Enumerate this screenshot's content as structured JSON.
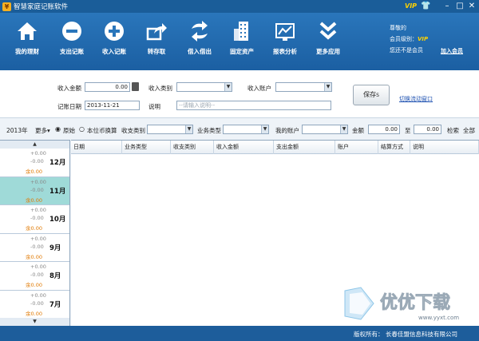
{
  "window": {
    "title": "智慧家庭记账软件",
    "vip": "VIP"
  },
  "toolbar": {
    "items": [
      {
        "label": "我的理财",
        "icon": "home-icon"
      },
      {
        "label": "支出记账",
        "icon": "minus-circle-icon"
      },
      {
        "label": "收入记账",
        "icon": "plus-circle-icon"
      },
      {
        "label": "转存取",
        "icon": "share-arrow-icon"
      },
      {
        "label": "借入借出",
        "icon": "exchange-icon"
      },
      {
        "label": "固定资产",
        "icon": "building-icon"
      },
      {
        "label": "报表分析",
        "icon": "chart-icon"
      },
      {
        "label": "更多应用",
        "icon": "chevron-double-down-icon"
      }
    ]
  },
  "member": {
    "greeting": "尊敬的",
    "level_label": "会员级别：",
    "level_value": "VIP",
    "status": "您还不是会员",
    "join": "加入会员"
  },
  "form": {
    "amount_label": "收入金额",
    "amount_value": "0.00",
    "category_label": "收入类别",
    "account_label": "收入账户",
    "date_label": "记账日期",
    "date_value": "2013-11-21",
    "note_label": "说明",
    "note_placeholder": "--请输入说明--",
    "save": "保存",
    "save_hotkey": "S",
    "switch_window": "切换流动窗口"
  },
  "filter": {
    "year": "2013年",
    "more": "更多▾",
    "radio_original": "原始",
    "radio_base": "本位币换算",
    "type_label": "收支类别",
    "biz_label": "业务类型",
    "account_label": "我的账户",
    "amount_label": "金额",
    "from": "0.00",
    "to_label": "至",
    "to": "0.00",
    "search": "检索",
    "all": "全部"
  },
  "months": [
    {
      "name": "12月",
      "inc": "+0.00",
      "exp": "-0.00",
      "bal": "余0.00",
      "active": false
    },
    {
      "name": "11月",
      "inc": "+0.00",
      "exp": "-0.00",
      "bal": "余0.00",
      "active": true
    },
    {
      "name": "10月",
      "inc": "+0.00",
      "exp": "-0.00",
      "bal": "余0.00",
      "active": false
    },
    {
      "name": "9月",
      "inc": "+0.00",
      "exp": "-0.00",
      "bal": "余0.00",
      "active": false
    },
    {
      "name": "8月",
      "inc": "+0.00",
      "exp": "-0.00",
      "bal": "余0.00",
      "active": false
    },
    {
      "name": "7月",
      "inc": "+0.00",
      "exp": "-0.00",
      "bal": "余0.00",
      "active": false
    }
  ],
  "table": {
    "columns": [
      "日期",
      "业务类型",
      "收支类别",
      "收入金额",
      "支出金额",
      "账户",
      "结算方式",
      "说明"
    ]
  },
  "footer": {
    "copyright": "版权所有：",
    "company": "长春佳盟信息科技有限公司"
  },
  "watermark": {
    "cn": "优优下载",
    "url": "www.yyxt.com"
  },
  "colors": {
    "titlebar": "#1a5d99",
    "toolbar": "#2a76bb",
    "active_month": "#9fdad8",
    "balance": "#e07800",
    "vip": "#ffd200"
  }
}
